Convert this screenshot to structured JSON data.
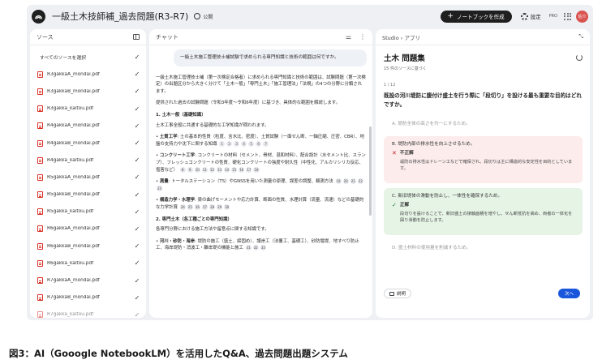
{
  "header": {
    "title": "一級土木技師補_過去問題(R3-R7)",
    "visibility": "公開",
    "create_button": "ノートブックを作成",
    "settings": "設定",
    "plan": "PRO",
    "avatar": "佐介"
  },
  "sources": {
    "title": "ソース",
    "select_all": "すべてのソースを選択",
    "items": [
      "R3gakkaA_mondai.pdf",
      "R3gakkaB_mondai.pdf",
      "R3gakka_kaitou.pdf",
      "R4gakkaA_mondai.pdf",
      "R4gakkaB_mondai.pdf",
      "R4gakka_kaitou.pdf",
      "R5gakkaA_mondai.pdf",
      "R5gakkaB_mondai.pdf",
      "R5gakka_kaitou.pdf",
      "R6gakkaA_mondai.pdf",
      "R6gakkaB_mondai.pdf",
      "R6gakka_kaitou.pdf",
      "R7gakkaA_mondai.pdf",
      "R7gakkaB_mondai.pdf",
      "R7gakka_kaitou.pdf"
    ]
  },
  "chat": {
    "title": "チャット",
    "question": "一級土木施工管理技士補試験で求められる専門知識と技術の範囲は何ですか。",
    "p1": "一級土木施工管理技士補（第一次検定合格者）に求められる専門知識と技術の範囲は、試験問題（第一次検定）の出題区分から大きく分けて「土木一般」「専門土木」「施工管理法」「法規」の4つの分野に分類されます。",
    "p2": "提供された過去の試験問題（令和3年度〜令和6年度）に基づき、具体的な範囲を解説します。",
    "h1": "1. 土木一般（基礎知識）",
    "p3": "土木工事全般に共通する基礎的な工学知識が問われます。",
    "b1_label": "土質工学",
    "b1_text": ": 土の基本的性質（粒度、含水比、密度）、土質試験（一面せん断、一軸圧縮、圧密、CBR）、地盤の支持力や沈下に関する知識",
    "b1_cites": [
      "1",
      "2",
      "3",
      "4",
      "5",
      "6",
      "7"
    ],
    "b2_label": "コンクリート工学",
    "b2_text": ": コンクリートの材料（セメント、骨材、混和材料）、配合設計（水セメント比、スランプ）、フレッシュコンクリートの性質、硬化コンクリートの強度や耐久性（中性化、アルカリシリカ反応、塩害など）",
    "b2_cites": [
      "8",
      "9",
      "10",
      "11",
      "12",
      "13",
      "14",
      "15",
      "16",
      "17",
      "18"
    ],
    "b3_label": "測量",
    "b3_text": ": トータルステーション（TS）やGNSSを用いた測量の原理、誤差の調整、観測方法",
    "b3_cites": [
      "19",
      "20",
      "21",
      "22",
      "23"
    ],
    "b4_label": "構造力学・水理学",
    "b4_text": ": 梁の曲げモーメントや応力計算、断面の性質、水理計算（流量、流速）などの基礎的な力学計算",
    "b4_cites": [
      "24",
      "25",
      "26",
      "27",
      "28",
      "29",
      "30"
    ],
    "h2": "2. 専門土木（各工種ごとの専門知識）",
    "p4": "各専門分野における施工方法や留意点に関する知識です。",
    "b5_label": "河川・砂防・海岸",
    "b5_text": ": 堤防の施工（盛土、締固め）、護岸工（法覆工、基礎工）、砂防堰堤、地すべり防止工、海岸堤防・消波工・離岸堤の機能と施工",
    "b5_cites": [
      "31",
      "32",
      "33"
    ]
  },
  "studio": {
    "breadcrumb_studio": "Studio",
    "breadcrumb_sep": "›",
    "breadcrumb_app": "アプリ",
    "quiz_title": "土木 問題集",
    "quiz_sub": "15 件のソースに基づく",
    "progress": "1 / 12",
    "question": "既設の河川堤防に腹付け盛土を行う際に「段切り」を設ける最も重要な目的はどれですか。",
    "options": {
      "a": "A.  堤防全体の高さを均一にするため。",
      "b": "B.  堤防内部の排水性を向上させるため。",
      "b_verdict": "不正解",
      "b_expl": "堤防の排水性はドレーン工などで確保され、段切りは主に構造的な安定性を目的としています。",
      "c": "C.  新旧堤体の滑動を防止し、一体性を確保するため。",
      "c_verdict": "正解",
      "c_expl": "段切りを設けることで、新旧盛土の接触面積を増やし、せん断抵抗を高め、両者の一体化を図り滑動を防止します。",
      "d": "D.  盛土材料の使用量を削減するため。"
    },
    "explain_button": "説明",
    "next_button": "次へ"
  },
  "caption": "図3：AI（Gooogle NotebookLM）を活用したQ&A、過去問題出題システム"
}
